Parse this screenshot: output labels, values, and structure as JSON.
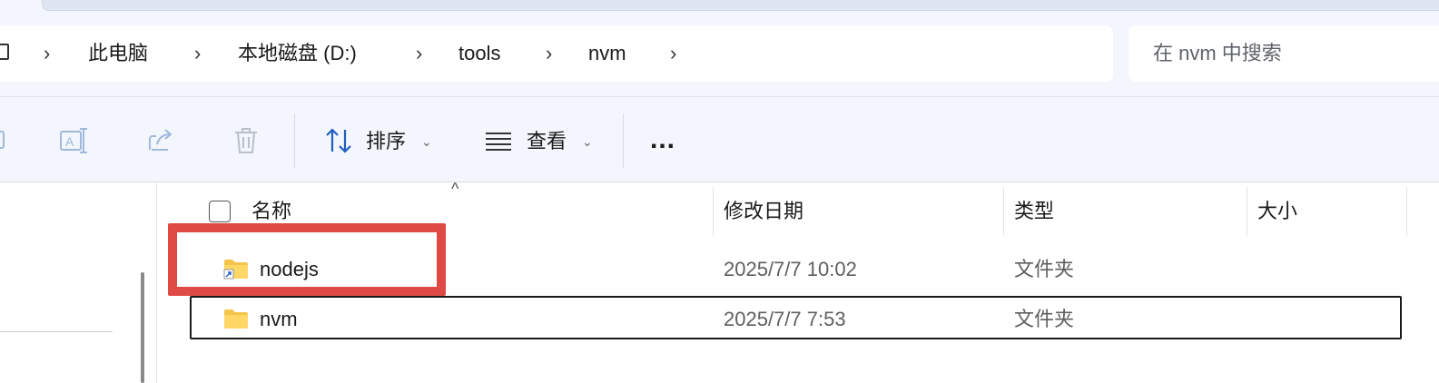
{
  "breadcrumb": [
    "此电脑",
    "本地磁盘 (D:)",
    "tools",
    "nvm"
  ],
  "search": {
    "placeholder": "在 nvm 中搜索"
  },
  "toolbar": {
    "icons": [
      "rename-icon",
      "share-icon",
      "delete-icon"
    ],
    "sort_label": "排序",
    "view_label": "查看",
    "more_label": "..."
  },
  "columns": {
    "name": "名称",
    "date": "修改日期",
    "type": "类型",
    "size": "大小"
  },
  "files": [
    {
      "name": "nodejs",
      "date": "2025/7/7 10:02",
      "type": "文件夹",
      "icon": "folder-shortcut-icon"
    },
    {
      "name": "nvm",
      "date": "2025/7/7 7:53",
      "type": "文件夹",
      "icon": "folder-icon"
    }
  ],
  "colors": {
    "highlight": "#e04a45",
    "folder": "#f4c54a",
    "accent": "#1f5fbf"
  }
}
